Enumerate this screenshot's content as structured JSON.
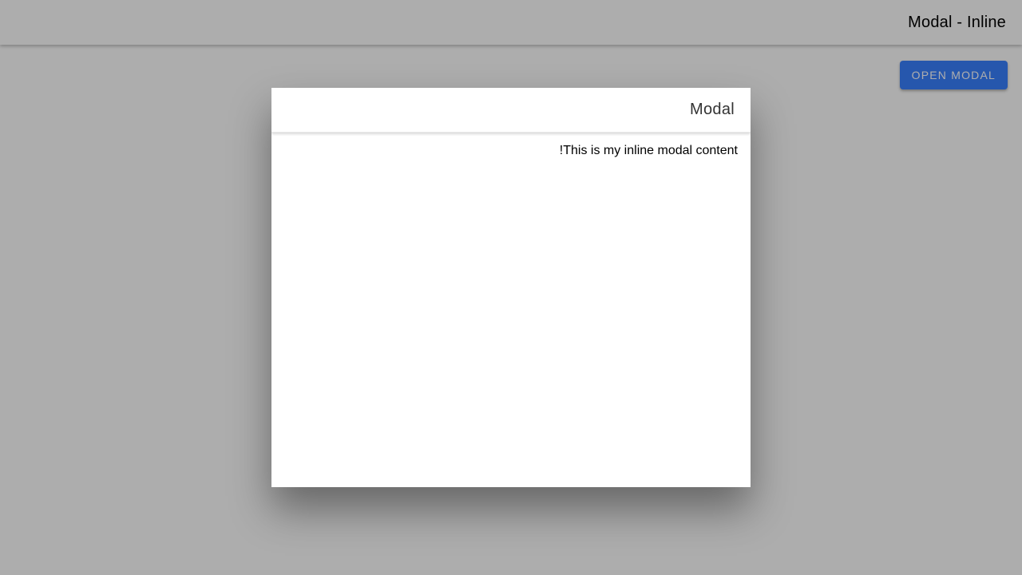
{
  "toolbar": {
    "title": "Modal - Inline"
  },
  "main": {
    "open_button_label": "Open Modal"
  },
  "modal": {
    "title": "Modal",
    "content": "This is my inline modal content!"
  },
  "colors": {
    "primary": "#3880ff",
    "backdrop": "rgba(0,0,0,0.32)"
  }
}
